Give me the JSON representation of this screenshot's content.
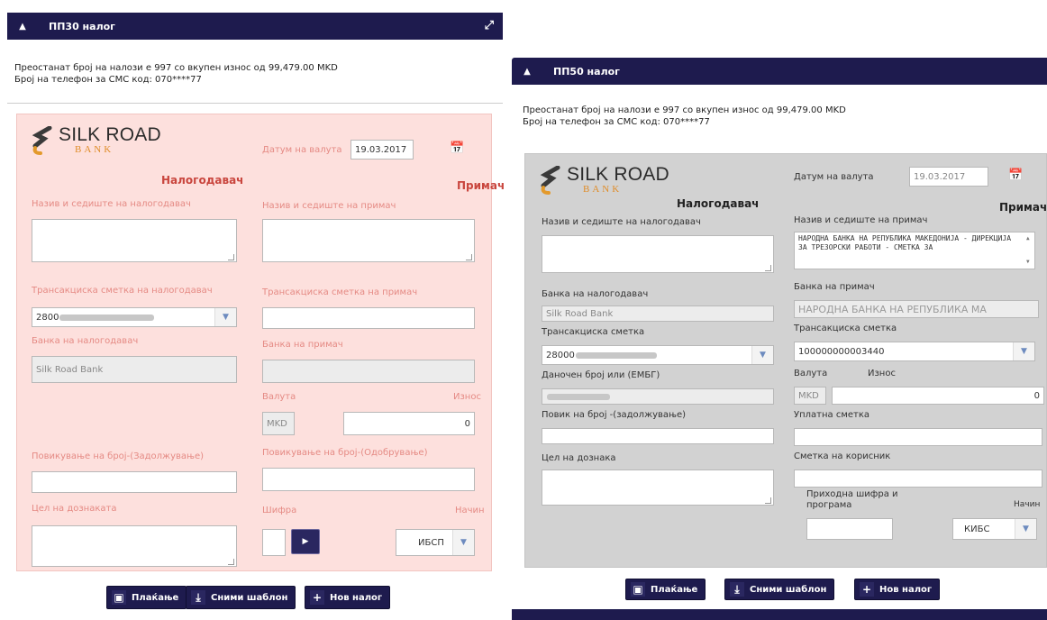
{
  "panel_left": {
    "title": "ПП30 налог",
    "info": [
      "Преостанат број на налози е 997 со вкупен износ од 99,479.00 MKD",
      "Број на телефон за СМС код: 070****77"
    ],
    "logo": {
      "name": "SILK ROAD",
      "sub": "BANK"
    },
    "payer_role": "Налогодавач",
    "payee_role": "Примач",
    "value_date_label": "Датум на валута",
    "value_date": "19.03.2017",
    "payer_name_label": "Назив и седиште на налогодавач",
    "payee_name_label": "Назив и седиште на примач",
    "payer_account_label": "Трансакциска сметка на налогодавач",
    "payee_account_label": "Трансакциска сметка на примач",
    "payer_account_value": "2800",
    "payer_bank_label": "Банка на налогодавач",
    "payer_bank_value": "Silk Road Bank",
    "payee_bank_label": "Банка на примач",
    "currency_label": "Валута",
    "amount_label": "Износ",
    "currency_value": "MKD",
    "amount_value": "0",
    "payer_ref_label": "Повикување на број-(Задолжување)",
    "payee_ref_label": "Повикување на број-(Одобрување)",
    "purpose_label": "Цел на дознаката",
    "code_label": "Шифра",
    "method_label": "Начин",
    "method_value": "ИБСП",
    "buttons": {
      "pay": "Плаќање",
      "save": "Сними шаблон",
      "new": "Нов налог"
    }
  },
  "panel_right": {
    "title": "ПП50 налог",
    "info": [
      "Преостанат број на налози е 997 со вкупен износ од 99,479.00 MKD",
      "Број на телефон за СМС код: 070****77"
    ],
    "logo": {
      "name": "SILK ROAD",
      "sub": "BANK"
    },
    "payer_role": "Налогодавач",
    "payee_role": "Примач",
    "value_date_label": "Датум на валута",
    "value_date": "19.03.2017",
    "payer_name_label": "Назив и седиште на налогодавач",
    "payee_name_label": "Назив и седиште на примач",
    "payee_name_value": "НАРОДНА БАНКА НА РЕПУБЛИКА МАКЕДОНИЈА - ДИРЕКЦИЈА ЗА ТРЕЗОРСКИ РАБОТИ - СМЕТКА ЗА",
    "payer_bank_label": "Банка на налогодавач",
    "payer_bank_value": "Silk Road Bank",
    "payee_bank_label": "Банка на примач",
    "payee_bank_value": "НАРОДНА БАНКА НА РЕПУБЛИКА МА",
    "payer_account_label": "Трансакциска сметка",
    "payer_account_value": "28000",
    "payee_account_label": "Трансакциска сметка",
    "payee_account_value": "100000000003440",
    "tax_label": "Даночен број или (ЕМБГ)",
    "currency_label": "Валута",
    "amount_label": "Износ",
    "currency_value": "MKD",
    "amount_value": "0",
    "ref_label": "Повик на број -(задолжување)",
    "deposit_label": "Уплатна сметка",
    "purpose_label": "Цел на дознака",
    "user_account_label": "Сметка на корисник",
    "revenue_code_label": "Приходна шифра и програма",
    "method_label": "Начин",
    "method_value": "КИБС",
    "buttons": {
      "pay": "Плаќање",
      "save": "Сними шаблон",
      "new": "Нов налог"
    }
  }
}
